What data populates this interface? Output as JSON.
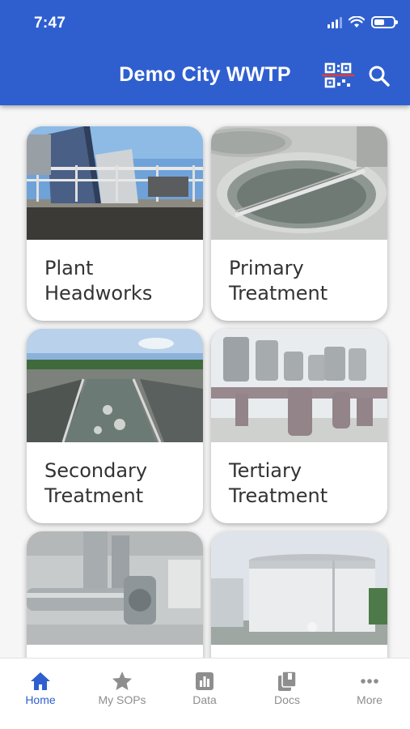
{
  "status_bar": {
    "time": "7:47"
  },
  "header": {
    "title": "Demo City WWTP"
  },
  "cards": [
    {
      "label": "Plant\nHeadworks"
    },
    {
      "label": "Primary\nTreatment"
    },
    {
      "label": "Secondary\nTreatment"
    },
    {
      "label": "Tertiary\nTreatment"
    },
    {
      "label": ""
    },
    {
      "label": ""
    }
  ],
  "tabs": [
    {
      "label": "Home",
      "icon": "home-icon",
      "active": true
    },
    {
      "label": "My SOPs",
      "icon": "star-icon",
      "active": false
    },
    {
      "label": "Data",
      "icon": "bar-chart-icon",
      "active": false
    },
    {
      "label": "Docs",
      "icon": "docs-icon",
      "active": false
    },
    {
      "label": "More",
      "icon": "more-icon",
      "active": false
    }
  ],
  "colors": {
    "brand": "#2f5fcf",
    "inactive_tab": "#8e8e8e"
  }
}
